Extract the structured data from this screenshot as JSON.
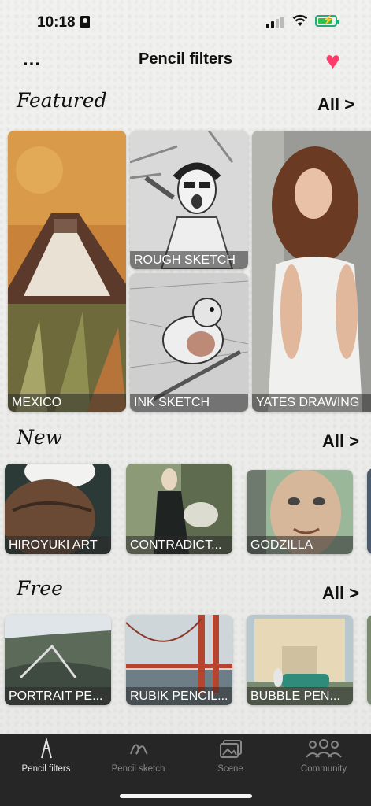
{
  "status": {
    "time": "10:18"
  },
  "header": {
    "title": "Pencil filters",
    "more_label": "...",
    "heart_icon": "heart-icon"
  },
  "sections": {
    "featured": {
      "title": "Featured",
      "all_label": "All >",
      "cards": [
        {
          "label": "MEXICO"
        },
        {
          "label": "ROUGH SKETCH"
        },
        {
          "label": "INK SKETCH"
        },
        {
          "label": "YATES DRAWING"
        }
      ]
    },
    "new": {
      "title": "New",
      "all_label": "All >",
      "cards": [
        {
          "label": "HIROYUKI ART"
        },
        {
          "label": "CONTRADICT..."
        },
        {
          "label": "GODZILLA"
        }
      ]
    },
    "free": {
      "title": "Free",
      "all_label": "All >",
      "cards": [
        {
          "label": "PORTRAIT PE..."
        },
        {
          "label": "RUBIK PENCIL..."
        },
        {
          "label": "BUBBLE PEN..."
        }
      ]
    }
  },
  "tabs": [
    {
      "label": "Pencil filters",
      "icon": "pencil-icon",
      "active": true
    },
    {
      "label": "Pencil sketch",
      "icon": "scribble-icon",
      "active": false
    },
    {
      "label": "Scene",
      "icon": "photos-icon",
      "active": false
    },
    {
      "label": "Community",
      "icon": "people-icon",
      "active": false
    }
  ],
  "colors": {
    "accent_heart": "#ff3b6b",
    "tabbar_bg": "#262626",
    "battery": "#2cc24a"
  }
}
